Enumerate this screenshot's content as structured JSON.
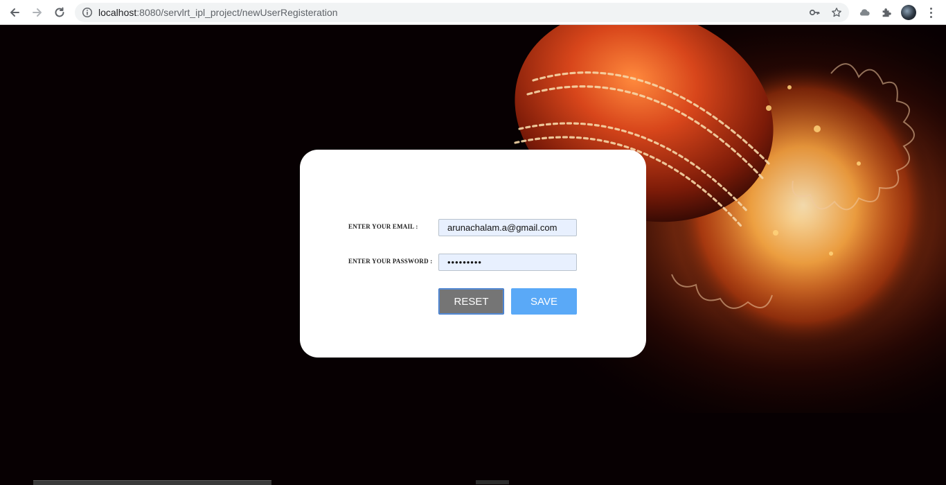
{
  "browser": {
    "url_host": "localhost",
    "url_rest": ":8080/servlrt_ipl_project/newUserRegisteration",
    "back_icon": "arrow-left-icon",
    "forward_icon": "arrow-right-icon",
    "reload_icon": "reload-icon",
    "site_info_icon": "info-icon",
    "password_key_icon": "key-icon",
    "bookmark_icon": "star-icon",
    "extension_icons": [
      "cloud-extension-icon",
      "puzzle-icon"
    ],
    "menu_icon": "three-dots-icon"
  },
  "form": {
    "email_label": "ENTER YOUR EMAIL :",
    "email_value": "arunachalam.a@gmail.com",
    "password_label": "ENTER YOUR PASSWORD :",
    "password_value": "•••••••••",
    "reset_label": "RESET",
    "save_label": "SAVE"
  },
  "colors": {
    "page_background": "#070002",
    "card_background": "#ffffff",
    "input_background": "#e8f0fe",
    "reset_button": "#757575",
    "save_button": "#5aa9f7"
  }
}
